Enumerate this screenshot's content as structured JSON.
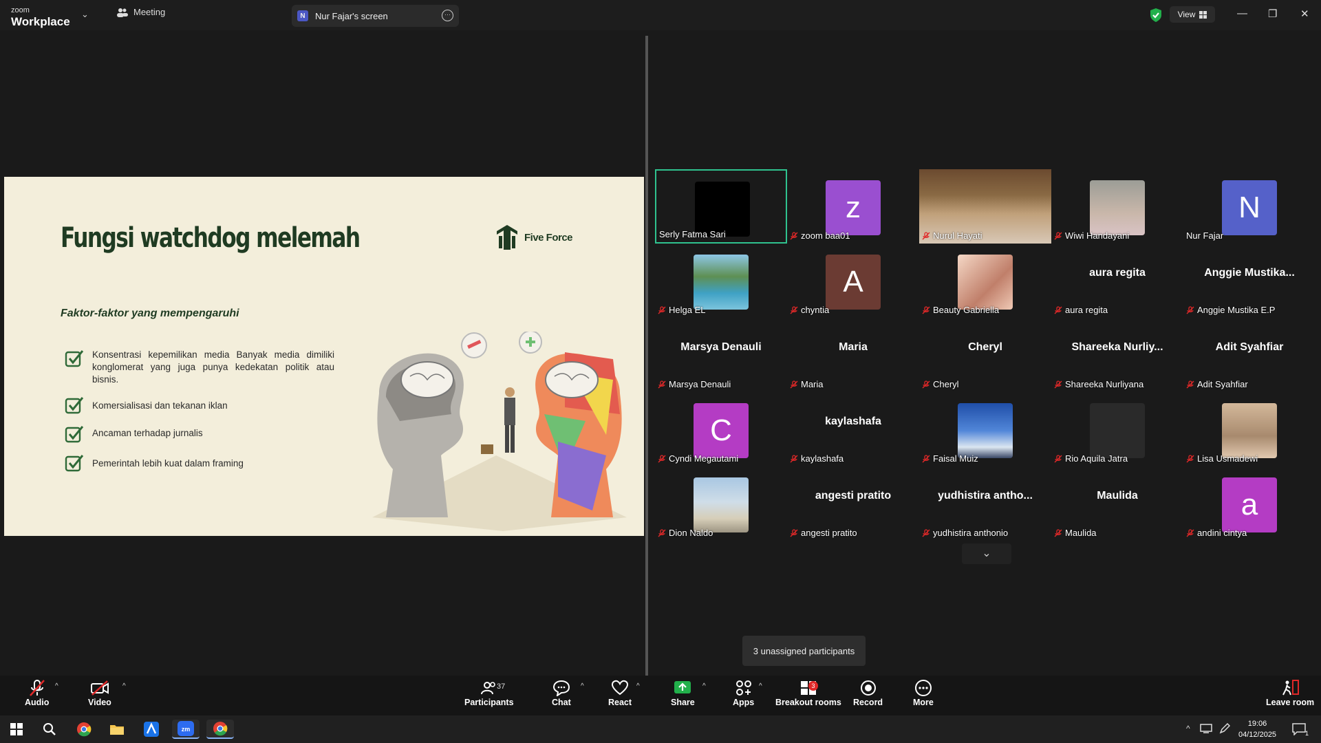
{
  "app": {
    "brand_small": "zoom",
    "brand_big": "Workplace"
  },
  "tabs": {
    "meeting": "Meeting",
    "screen": "Nur Fajar's screen",
    "screen_avatar": "N"
  },
  "view_label": "View",
  "slide": {
    "title": "Fungsi watchdog melemah",
    "logo": "Five Force",
    "subtitle": "Faktor-faktor yang mempengaruhi",
    "bullets": [
      "Konsentrasi kepemilikan media Banyak media dimiliki konglomerat yang juga punya kedekatan politik atau bisnis.",
      "Komersialisasi dan tekanan iklan",
      "Ancaman terhadap jurnalis",
      "Pemerintah lebih kuat dalam framing"
    ]
  },
  "participants": [
    {
      "name": "Serly Fatma Sari",
      "display": "",
      "tile": "black",
      "muted": false,
      "active": true
    },
    {
      "name": "zoom baa01",
      "display": "z",
      "tile": "#9a4fd0",
      "muted": true
    },
    {
      "name": "Nurul Hayati",
      "display": "",
      "tile": "video",
      "muted": true
    },
    {
      "name": "Wiwi Handayani",
      "display": "",
      "tile": "photo",
      "muted": true
    },
    {
      "name": "Nur Fajar",
      "display": "N",
      "tile": "#5561c9",
      "muted": false
    },
    {
      "name": "Helga EL",
      "display": "",
      "tile": "photo-lake",
      "muted": true
    },
    {
      "name": "chyntia",
      "display": "A",
      "tile": "#6b3b33",
      "muted": true
    },
    {
      "name": "Beauty Gabriella",
      "display": "",
      "tile": "photo-peach",
      "muted": true
    },
    {
      "name": "aura regita",
      "display": "aura regita",
      "tile": "none",
      "muted": true
    },
    {
      "name": "Anggie Mustika E.P",
      "display": "Anggie  Mustika...",
      "tile": "none",
      "muted": true
    },
    {
      "name": "Marsya Denauli",
      "display": "Marsya Denauli",
      "tile": "none",
      "muted": true
    },
    {
      "name": "Maria",
      "display": "Maria",
      "tile": "none",
      "muted": true
    },
    {
      "name": "Cheryl",
      "display": "Cheryl",
      "tile": "none",
      "muted": true
    },
    {
      "name": "Shareeka Nurliyana",
      "display": "Shareeka  Nurliy...",
      "tile": "none",
      "muted": true
    },
    {
      "name": "Adit Syahfiar",
      "display": "Adit Syahfiar",
      "tile": "none",
      "muted": true
    },
    {
      "name": "Cyndi Megautami",
      "display": "C",
      "tile": "#b43cc4",
      "muted": true
    },
    {
      "name": "kaylashafa",
      "display": "kaylashafa",
      "tile": "none",
      "muted": true
    },
    {
      "name": "Faisal Muiz",
      "display": "",
      "tile": "photo-sky",
      "muted": true
    },
    {
      "name": "Rio Aquila Jatra",
      "display": "",
      "tile": "#2a2a2a",
      "muted": true
    },
    {
      "name": "Lisa Usmadewi",
      "display": "",
      "tile": "photo-people",
      "muted": true
    },
    {
      "name": "Dion Naldo",
      "display": "",
      "tile": "photo-beach",
      "muted": true
    },
    {
      "name": "angesti pratito",
      "display": "angesti pratito",
      "tile": "none",
      "muted": true
    },
    {
      "name": "yudhistira anthonio",
      "display": "yudhistira  antho...",
      "tile": "none",
      "muted": true
    },
    {
      "name": "Maulida",
      "display": "Maulida",
      "tile": "none",
      "muted": true
    },
    {
      "name": "andini cintya",
      "display": "a",
      "tile": "#b43cc4",
      "muted": true
    }
  ],
  "tooltip": "3 unassigned participants",
  "toolbar": {
    "audio": "Audio",
    "video": "Video",
    "participants": "Participants",
    "participants_count": "37",
    "chat": "Chat",
    "react": "React",
    "share": "Share",
    "apps": "Apps",
    "breakout": "Breakout rooms",
    "breakout_badge": "3",
    "record": "Record",
    "more": "More",
    "leave": "Leave room"
  },
  "taskbar": {
    "time": "19:06",
    "date": "04/12/2025",
    "notif": "1"
  },
  "colors": {
    "accent_green": "#2fc38f",
    "slide_bg": "#f3eedb",
    "slide_dark": "#1f3b22",
    "mute_red": "#e02828"
  }
}
